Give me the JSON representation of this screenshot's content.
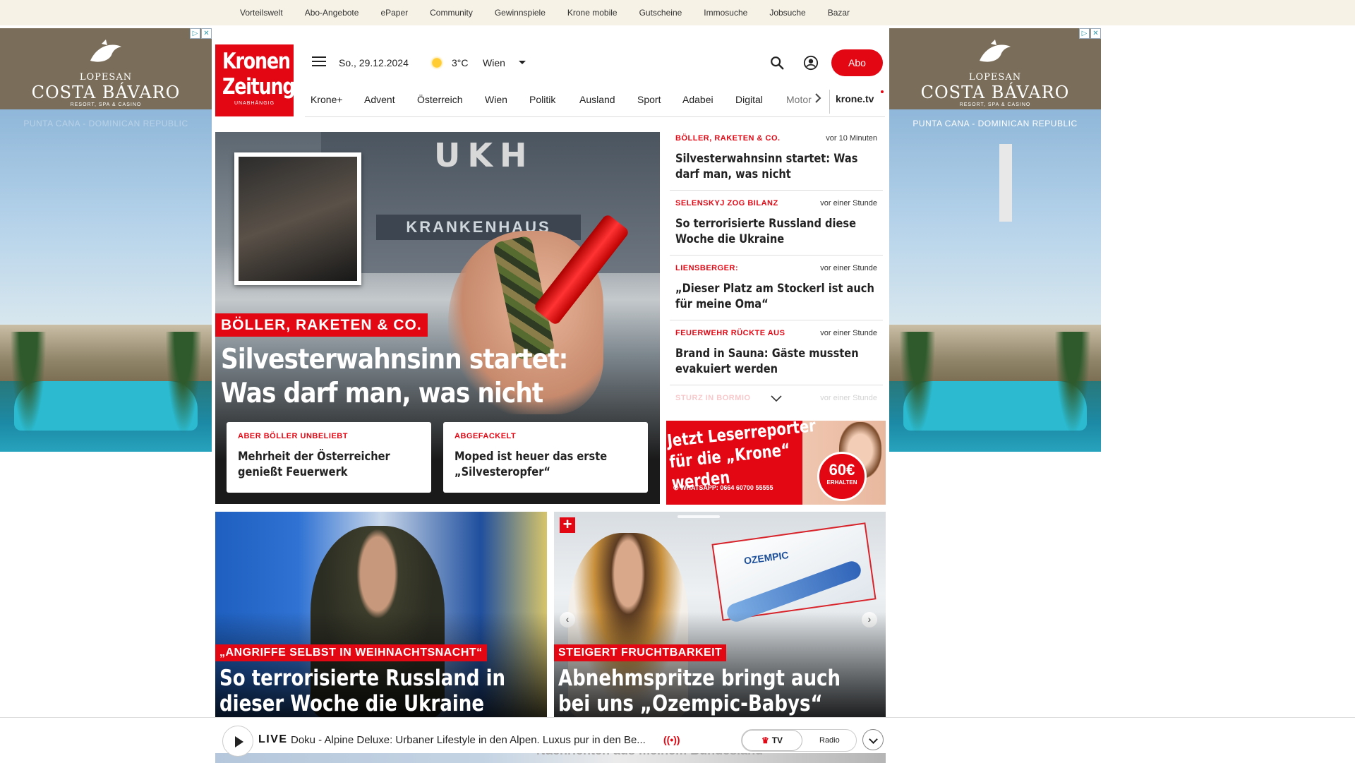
{
  "topbar": {
    "links": [
      "Vorteilswelt",
      "Abo-Angebote",
      "ePaper",
      "Community",
      "Gewinnspiele",
      "Krone mobile",
      "Gutscheine",
      "Immosuche",
      "Jobsuche",
      "Bazar"
    ]
  },
  "ads": {
    "left": {
      "brand_top": "LOPESAN",
      "brand_main": "COSTA BÁVARO",
      "brand_sub": "RESORT, SPA & CASINO",
      "place": "PUNTA CANA - DOMINICAN REPUBLIC"
    },
    "right": {
      "brand_top": "LOPESAN",
      "brand_main": "COSTA BÁVARO",
      "brand_sub": "RESORT, SPA & CASINO",
      "place": "PUNTA CANA - DOMINICAN REPUBLIC"
    }
  },
  "header": {
    "logo_line1": "Kronen",
    "logo_line2": "Zeitung",
    "logo_line3": "UNABHÄNGIG",
    "date": "So., 29.12.2024",
    "temperature": "3°C",
    "city": "Wien",
    "abo_label": "Abo"
  },
  "nav": {
    "items": [
      "Krone+",
      "Advent",
      "Österreich",
      "Wien",
      "Politik",
      "Ausland",
      "Sport",
      "Adabei",
      "Digital",
      "Motor"
    ],
    "kronetv": "krone.tv"
  },
  "hero": {
    "sign_ukh": "UKH",
    "sign_kh": "KRANKENHAUS",
    "kicker": "BÖLLER, RAKETEN & CO.",
    "headline_line1": "Silvesterwahnsinn startet:",
    "headline_line2": "Was darf man, was nicht",
    "subs": [
      {
        "kicker": "ABER BÖLLER UNBELIEBT",
        "title": "Mehrheit der Österreicher genießt Feuerwerk"
      },
      {
        "kicker": "ABGEFACKELT",
        "title": "Moped ist heuer das erste „Silvesteropfer“"
      }
    ]
  },
  "news": [
    {
      "kicker": "BÖLLER, RAKETEN & CO.",
      "time": "vor 10 Minuten",
      "title": "Silvesterwahnsinn startet: Was darf man, was nicht"
    },
    {
      "kicker": "SELENSKYJ ZOG BILANZ",
      "time": "vor einer Stunde",
      "title": "So terrorisierte Russland diese Woche die Ukraine"
    },
    {
      "kicker": "LIENSBERGER:",
      "time": "vor einer Stunde",
      "title": "„Dieser Platz am Stockerl ist auch für meine Oma“"
    },
    {
      "kicker": "FEUERWEHR RÜCKTE AUS",
      "time": "vor einer Stunde",
      "title": "Brand in Sauna: Gäste mussten evakuiert werden"
    },
    {
      "kicker": "STURZ IN BORMIO",
      "time": "vor einer Stunde",
      "title": ""
    }
  ],
  "reporter_banner": {
    "line1": "Jetzt Leserreporter",
    "line2": "für die „Krone“ werden",
    "whatsapp": "WHATSAPP: 0664 60700 55555",
    "price": "60€",
    "price_sub": "ERHALTEN"
  },
  "cards": [
    {
      "kicker": "„ANGRIFFE SELBST IN WEIHNACHTSNACHT“",
      "line1": "So terrorisierte Russland in",
      "line2": "dieser Woche die Ukraine"
    },
    {
      "kicker": "STEIGERT FRUCHTBARKEIT",
      "line1": "Abnehmspritze bringt auch",
      "line2": "bei uns „Ozempic-Babys“",
      "box_label": "OZEMPIC"
    }
  ],
  "player": {
    "live_label": "LIVE",
    "now_playing": "Doku - Alpine Deluxe: Urbaner Lifestyle in den Alpen. Luxus pur in den Be...",
    "tv_label": "TV",
    "radio_label": "Radio",
    "behind_text": "Nachrichten aus meinem Bundesland"
  },
  "colors": {
    "brand_red": "#e30613",
    "topbar_bg": "#f6f2e6"
  }
}
